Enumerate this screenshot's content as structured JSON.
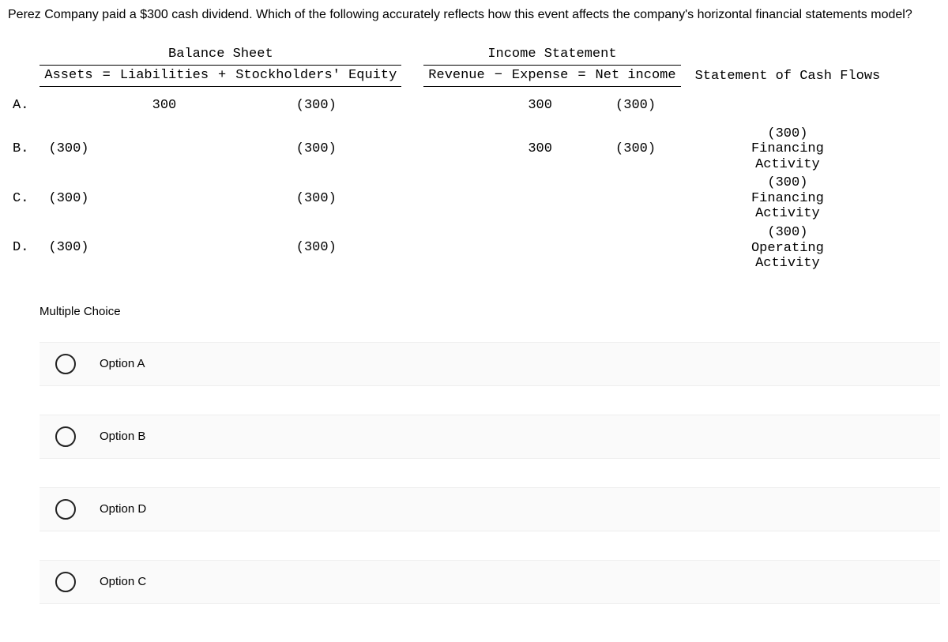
{
  "question": "Perez Company paid a $300 cash dividend. Which of the following accurately reflects how this event affects the company's horizontal financial statements model?",
  "headers": {
    "balance_sheet": "Balance Sheet",
    "income_stmt": "Income Statement",
    "assets": "Assets",
    "eq1": "=",
    "liab": "Liabilities",
    "plus": "+",
    "stockholders": "Stockholders' Equity",
    "revenue": "Revenue",
    "minus": "−",
    "expense": "Expense",
    "eq2": "=",
    "net_income": "Net income",
    "cash": "Statement of Cash Flows"
  },
  "rows": {
    "A": {
      "label": "A.",
      "assets": "",
      "liab": "300",
      "equity": "(300)",
      "rev": "",
      "exp": "300",
      "ni": "(300)",
      "cash": ""
    },
    "B": {
      "label": "B.",
      "assets": "(300)",
      "liab": "",
      "equity": "(300)",
      "rev": "",
      "exp": "300",
      "ni": "(300)",
      "cash": "(300) Financing Activity"
    },
    "C": {
      "label": "C.",
      "assets": "(300)",
      "liab": "",
      "equity": "(300)",
      "rev": "",
      "exp": "",
      "ni": "",
      "cash": "(300) Financing Activity"
    },
    "D": {
      "label": "D.",
      "assets": "(300)",
      "liab": "",
      "equity": "(300)",
      "rev": "",
      "exp": "",
      "ni": "",
      "cash": "(300) Operating Activity"
    }
  },
  "mc_label": "Multiple Choice",
  "options": [
    {
      "label": "Option A"
    },
    {
      "label": "Option B"
    },
    {
      "label": "Option D"
    },
    {
      "label": "Option C"
    }
  ]
}
